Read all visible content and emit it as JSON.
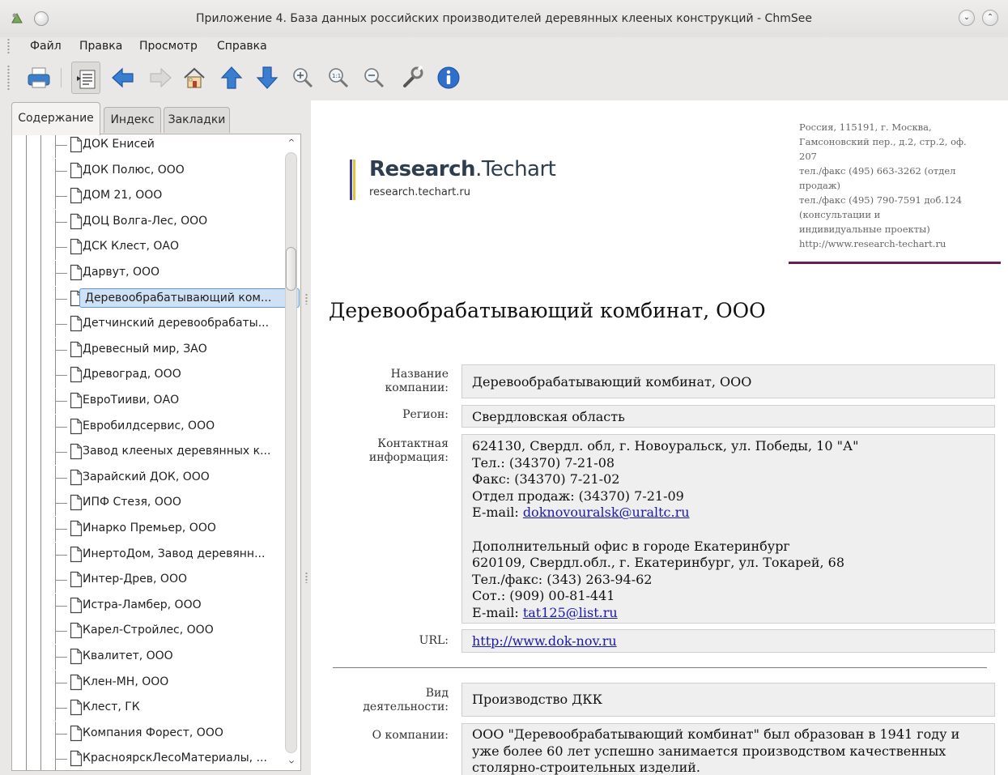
{
  "window": {
    "title": "Приложение 4. База данных российских производителей деревянных клееных конструкций - ChmSee",
    "minimize_glyph": "⌄",
    "maximize_glyph": "⌃"
  },
  "menu": [
    "Файл",
    "Правка",
    "Просмотр",
    "Справка"
  ],
  "toolbar": [
    "print-icon",
    "sync-toc-icon",
    "back-arrow-icon",
    "forward-arrow-icon",
    "home-icon",
    "up-arrow-icon",
    "down-arrow-icon",
    "zoom-in-icon",
    "zoom-reset-icon",
    "zoom-out-icon",
    "preferences-wrench-icon",
    "info-icon"
  ],
  "sidebar": {
    "tabs": [
      "Содержание",
      "Индекс",
      "Закладки"
    ],
    "active_tab": "Содержание",
    "items": [
      "ДОК Енисей",
      "ДОК Полюс, ООО",
      "ДОМ 21, ООО",
      "ДОЦ Волга-Лес, ООО",
      "ДСК Клест, ОАО",
      "Дарвут, ООО",
      "Деревообрабатывающий ком...",
      "Детчинский деревообрабаты...",
      "Древесный мир, ЗАО",
      "Древоград, ООО",
      "ЕвроТииви, ОАО",
      "Евробилдсервис, ООО",
      "Завод клееных деревянных к...",
      "Зарайский ДОК, ООО",
      "ИПФ Стезя, ООО",
      "Инарко Премьер, ООО",
      "ИнертоДом, Завод деревянн...",
      "Интер-Древ, ООО",
      "Истра-Ламбер, ООО",
      "Карел-Стройлес, ООО",
      "Квалитет, ООО",
      "Клен-МН, ООО",
      "Клест, ГК",
      "Компания Форест, ООО",
      "КрасноярскЛесоМатериалы, ..."
    ],
    "selected_index": 6,
    "scroll_up_glyph": "^",
    "scroll_down_glyph": "^"
  },
  "page": {
    "logo_bold": "Research",
    "logo_rest": ".Techart",
    "logo_url": "research.techart.ru",
    "address_lines": [
      "Россия, 115191, г. Москва,",
      "Гамсоновский пер., д.2, стр.2, оф.",
      "207",
      "тел./факс (495) 663-3262 (отдел",
      "продаж)",
      "тел./факс (495) 790-7591 доб.124",
      "(консультации и",
      "индивидуальные проекты)",
      "http://www.research-techart.ru"
    ],
    "title": "Деревообрабатывающий комбинат, ООО",
    "fields": {
      "company": {
        "label_1": "Название",
        "label_2": "компании:",
        "value": "Деревообрабатывающий комбинат, ООО"
      },
      "region": {
        "label": "Регион:",
        "value": "Свердловская область"
      },
      "contact": {
        "label_1": "Контактная",
        "label_2": "информация:",
        "lines": [
          "624130, Свердл. обл, г. Новоуральск, ул. Победы, 10 \"А\"",
          "Тел.: (34370) 7-21-08",
          "Факс: (34370) 7-21-02",
          "Отдел продаж: (34370) 7-21-09"
        ],
        "email_prefix": "E-mail: ",
        "email": "doknovouralsk@uraltc.ru",
        "lines2": [
          "Дополнительный офис в городе Екатеринбург",
          "620109, Свердл.обл., г. Екатеринбург, ул. Токарей, 68",
          "Тел./факс: (343) 263-94-62",
          "Сот.: (909) 00-81-441"
        ],
        "email2": "tat125@list.ru"
      },
      "url": {
        "label": "URL:",
        "value": "http://www.dok-nov.ru"
      },
      "activity": {
        "label_1": "Вид",
        "label_2": "деятельности:",
        "value": "Производство ДКК"
      },
      "about": {
        "label": "О компании:",
        "lines": [
          "ООО \"Деревообрабатывающий комбинат\" был образован в 1941 году и",
          "уже более 60 лет успешно занимается производством качественных",
          "столярно-строительных изделий."
        ]
      }
    }
  }
}
